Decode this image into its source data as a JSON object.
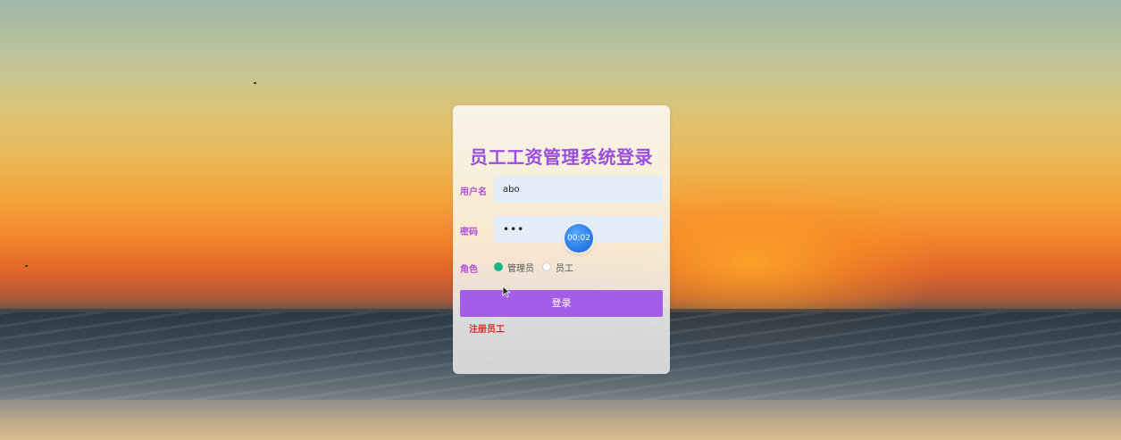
{
  "login": {
    "title": "员工工资管理系统登录",
    "username_label": "用户名",
    "username_value": "abo",
    "password_label": "密码",
    "password_value": "•••",
    "role_label": "角色",
    "roles": [
      {
        "label": "管理员",
        "selected": true
      },
      {
        "label": "员工",
        "selected": false
      }
    ],
    "login_button": "登录",
    "register_link": "注册员工"
  },
  "overlay": {
    "timer": "00:02"
  },
  "colors": {
    "title": "#9a4fdc",
    "label": "#b04fd8",
    "button": "#a45de6",
    "radio_selected": "#19b58a",
    "register_link": "#e8262a",
    "input_bg": "#e3edf8"
  },
  "icons": {
    "cursor": "mouse-pointer-icon"
  }
}
